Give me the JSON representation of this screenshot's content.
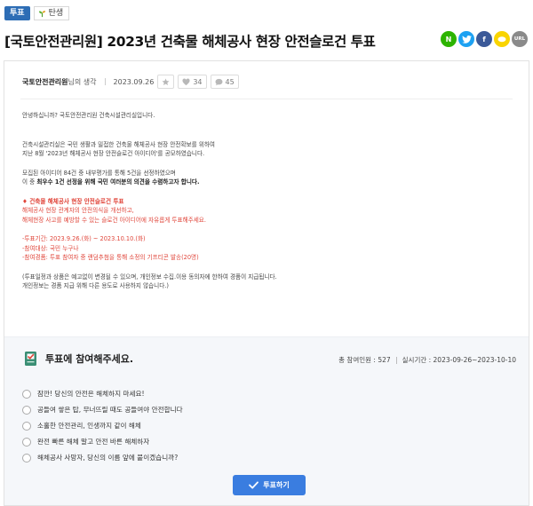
{
  "tags": {
    "vote": "투표",
    "category": "탄생"
  },
  "title": "[국토안전관리원] 2023년 건축물 해체공사 현장 안전슬로건 투표",
  "share": {
    "naver": "N",
    "twitter": "t",
    "facebook": "f",
    "kakaostory": "S",
    "url": "URL"
  },
  "meta": {
    "author": "국토안전관리원",
    "author_suffix": "님의 생각",
    "date": "2023.09.26",
    "likes": "34",
    "comments": "45"
  },
  "body": {
    "greeting": "안녕하십니까? 국토안전관리원 건축시설관리실입니다.",
    "p1_line1": "건축시설관리실은 국민 생활과 밀접한 건축물 해체공사 현장 안전확보를 위하여",
    "p1_line2": "지난 8월 '2023년 해체공사 현장 안전슬로건 아이디어'를 공모하였습니다.",
    "p2_line1": "모집된 아이디어 84건 중 내부평가를 통해 5건을 선정하였으며",
    "p2_line2_pre": "이 중 ",
    "p2_line2_bold": "최우수 1건 선정을 위해 국민 여러분의 의견을 수렴하고자 합니다.",
    "purpose_title": "♦ 건축물 해체공사 현장 안전슬로건 투표",
    "purpose_line1": "해체공사 현장 관계자의 안전의식을 개선하고,",
    "purpose_line2": "해체현장 사고를 예방할 수 있는 슬로건 아이디어에 자유롭게 투표해주세요.",
    "period": "-투표기간: 2023.9.26.(화) ~ 2023.10.10.(화)",
    "target": "-참여대상: 국민 누구나",
    "prize": "-참여경품: 투표 참여자 중 랜덤추첨을 통해 소정의 기프티콘 발송(20명)",
    "note_line1": "(투표일정과 상품은 예고없이 변경될 수 있으며, 개인정보 수집.이용 동의자에 한하여 경품이 지급됩니다.",
    "note_line2": " 개인정보는 경품 지급 위해 다른 용도로 사용하지 않습니다.)"
  },
  "vote": {
    "title": "투표에 참여해주세요.",
    "participants": "총 참여인원 : 527",
    "period": "실시기간 : 2023-09-26~2023-10-10",
    "options": [
      "잠깐! 당신의 안전은 해체하지 마세요!",
      "공들여 쌓은 탑, 무너뜨릴 때도 공들여야 안전합니다",
      "소홀한 안전관리, 인생까지 같이 해체",
      "완전 빠른 해체 말고 안전 바른 해체하자",
      "해체공사 사망자, 당신의 이름 앞에 붙이겠습니까?"
    ],
    "submit": "투표하기"
  }
}
